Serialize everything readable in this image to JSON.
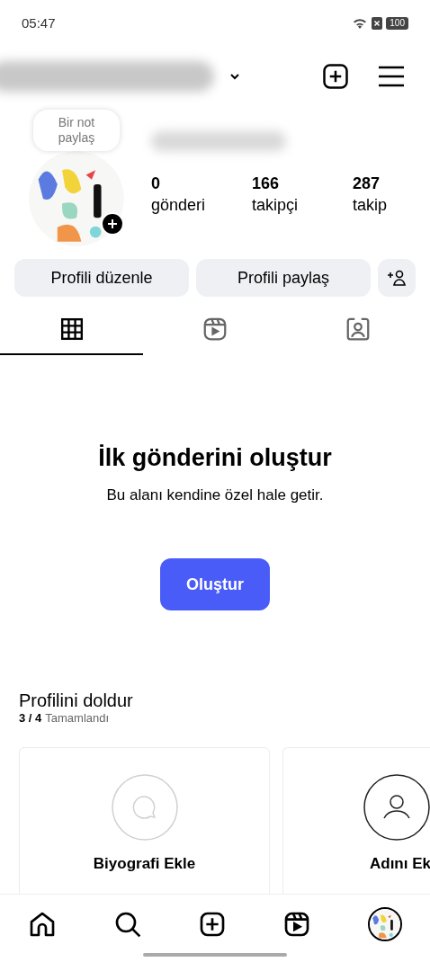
{
  "status_bar": {
    "time": "05:47",
    "battery": "100"
  },
  "profile": {
    "note": "Bir not paylaş",
    "stats": [
      {
        "value": "0",
        "label": "gönderi"
      },
      {
        "value": "166",
        "label": "takipçi"
      },
      {
        "value": "287",
        "label": "takip"
      }
    ]
  },
  "buttons": [
    "Profili düzenle",
    "Profili paylaş"
  ],
  "tabs": [
    {
      "kind": "grid",
      "selected": true
    },
    {
      "kind": "reels",
      "selected": false
    },
    {
      "kind": "tagged",
      "selected": false
    }
  ],
  "empty_state": {
    "title": "İlk gönderini oluştur",
    "subtitle": "Bu alanı kendine özel hale getir.",
    "button": "Oluştur"
  },
  "complete_profile": {
    "title": "Profilini doldur",
    "progress": "3 / 4",
    "progress_label": "Tamamlandı",
    "cards": [
      {
        "kind": "bio",
        "label": "Biyografi Ekle",
        "done": false
      },
      {
        "kind": "name",
        "label": "Adını Ek",
        "done": true
      }
    ]
  },
  "nav": [
    {
      "kind": "home"
    },
    {
      "kind": "search"
    },
    {
      "kind": "create"
    },
    {
      "kind": "reels"
    },
    {
      "kind": "profile"
    }
  ]
}
